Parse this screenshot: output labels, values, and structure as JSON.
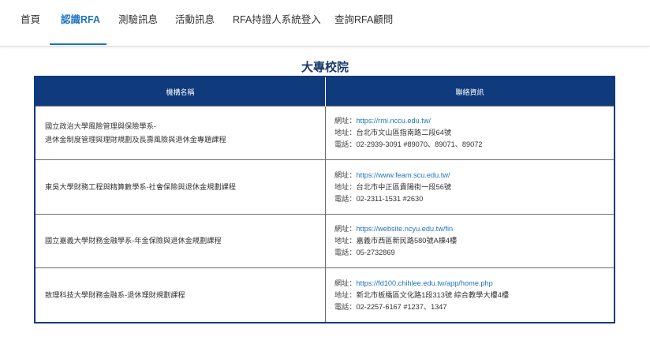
{
  "nav": {
    "items": [
      {
        "label": "首頁",
        "active": false
      },
      {
        "label": "認識RFA",
        "active": true
      },
      {
        "label": "測驗訊息",
        "active": false
      },
      {
        "label": "活動訊息",
        "active": false
      },
      {
        "label": "RFA持證人系統登入",
        "active": false
      },
      {
        "label": "查詢RFA顧問",
        "active": false
      }
    ]
  },
  "section": {
    "title": "大專校院"
  },
  "table": {
    "headers": [
      "機構名稱",
      "聯絡資訊"
    ],
    "labels": {
      "website": "網址：",
      "address": "地址：",
      "phone": "電話："
    },
    "rows": [
      {
        "name_lines": [
          "國立政治大學風險管理與保險學系-",
          "退休金制度管理與理財規劃及長壽風險與退休金專題課程"
        ],
        "website": "https://rmi.nccu.edu.tw/",
        "address": "台北市文山區指南路二段64號",
        "phone": "02-2939-3091 #89070、89071、89072"
      },
      {
        "name_lines": [
          "東吳大學財務工程與精算數學系-社會保險與退休金規劃課程"
        ],
        "website": "https://www.feam.scu.edu.tw/",
        "address": "台北市中正區貴陽街一段56號",
        "phone": "02-2311-1531 #2630"
      },
      {
        "name_lines": [
          "國立嘉義大學財務金融學系-年金保險與退休金規劃課程"
        ],
        "website": "https://website.ncyu.edu.tw/fin",
        "address": "嘉義市西區新民路580號A棟4樓",
        "phone": "05-2732869"
      },
      {
        "name_lines": [
          "致理科技大學財務金融系-退休理財規劃課程"
        ],
        "website": "https://fd100.chihlee.edu.tw/app/home.php",
        "address": "新北市板橋區文化路1段313號 綜合教學大樓4樓",
        "phone": "02-2257-6167 #1237、1347"
      }
    ]
  }
}
